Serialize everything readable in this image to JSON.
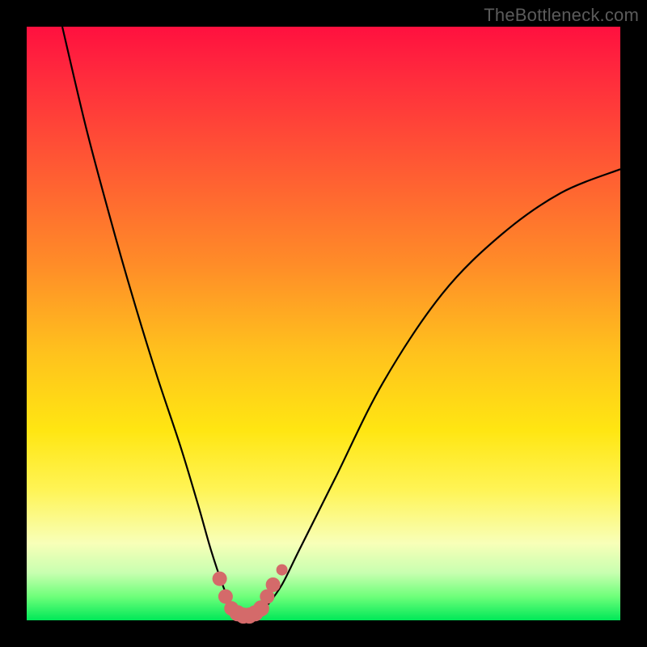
{
  "watermark": "TheBottleneck.com",
  "colors": {
    "frame": "#000000",
    "curve": "#000000",
    "marker": "#d46a6a",
    "gradient_stops": [
      "#ff103f",
      "#ff5b33",
      "#ffc21d",
      "#fff455",
      "#f8ffb8",
      "#00e858"
    ]
  },
  "chart_data": {
    "type": "line",
    "title": "",
    "xlabel": "",
    "ylabel": "",
    "xlim": [
      0,
      100
    ],
    "ylim": [
      0,
      100
    ],
    "grid": false,
    "legend": false,
    "series": [
      {
        "name": "bottleneck-curve",
        "x": [
          6,
          10,
          14,
          18,
          22,
          26,
          29,
          31,
          33,
          34.5,
          36,
          37.5,
          39,
          40.5,
          43,
          46,
          52,
          60,
          70,
          80,
          90,
          100
        ],
        "values": [
          100,
          83,
          68,
          54,
          41,
          29,
          19,
          12,
          6,
          2.5,
          1,
          0.5,
          1,
          2.5,
          6,
          12,
          24,
          40,
          55,
          65,
          72,
          76
        ]
      }
    ],
    "markers": {
      "name": "highlighted-range",
      "x": [
        32.5,
        33.5,
        34.5,
        35.5,
        36.5,
        37.5,
        38.5,
        39.5,
        40.5,
        41.5,
        43.0
      ],
      "values": [
        7.0,
        4.0,
        2.0,
        1.2,
        0.8,
        0.8,
        1.2,
        2.0,
        4.0,
        6.0,
        8.5
      ],
      "radius": [
        9,
        9,
        9,
        10,
        10,
        10,
        10,
        10,
        9,
        9,
        7
      ]
    }
  }
}
